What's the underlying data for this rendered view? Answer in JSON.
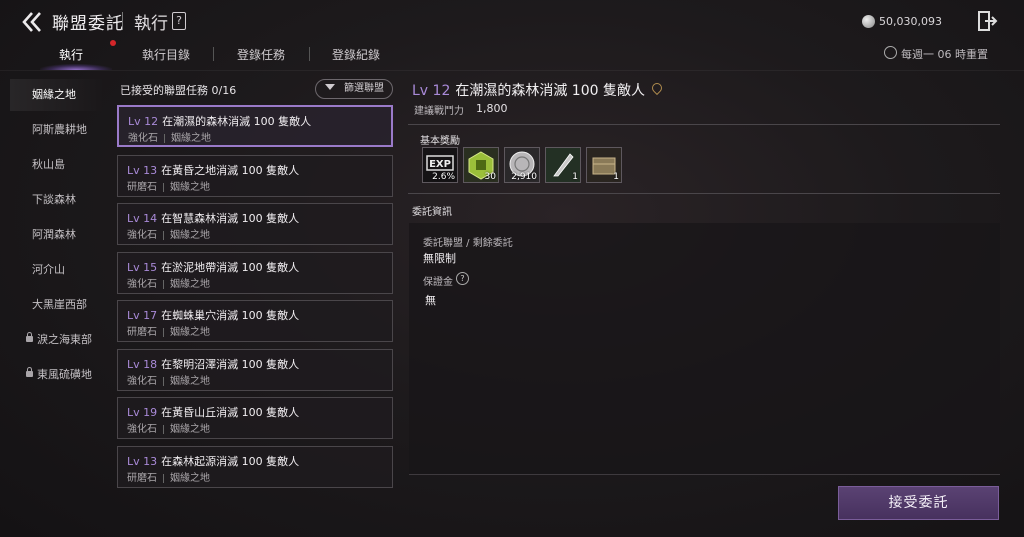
{
  "header": {
    "title": "聯盟委託",
    "subtitle": "執行",
    "currency": "50,030,093"
  },
  "tabs": [
    {
      "label": "執行",
      "active": true
    },
    {
      "label": "執行目錄"
    },
    {
      "label": "登錄任務"
    },
    {
      "label": "登錄紀錄"
    }
  ],
  "reset_text": "每週一 06 時重置",
  "regions": [
    {
      "label": "姻緣之地",
      "active": true
    },
    {
      "label": "阿斯農耕地"
    },
    {
      "label": "秋山島"
    },
    {
      "label": "下談森林"
    },
    {
      "label": "阿潤森林"
    },
    {
      "label": "河介山"
    },
    {
      "label": "大黑崖西部"
    },
    {
      "label": "淚之海東部",
      "locked": true
    },
    {
      "label": "東風硫磺地",
      "locked": true
    }
  ],
  "list": {
    "label": "已接受的聯盟任務 0/16",
    "filter_label": "篩選聯盟",
    "quests": [
      {
        "lv": "Lv 12",
        "title": "在潮濕的森林消滅 100 隻敵人",
        "item": "強化石",
        "region": "姻緣之地"
      },
      {
        "lv": "Lv 13",
        "title": "在黃昏之地消滅 100 隻敵人",
        "item": "研磨石",
        "region": "姻緣之地"
      },
      {
        "lv": "Lv 14",
        "title": "在智慧森林消滅 100 隻敵人",
        "item": "強化石",
        "region": "姻緣之地"
      },
      {
        "lv": "Lv 15",
        "title": "在淤泥地帶消滅 100 隻敵人",
        "item": "強化石",
        "region": "姻緣之地"
      },
      {
        "lv": "Lv 17",
        "title": "在蜘蛛巢穴消滅 100 隻敵人",
        "item": "研磨石",
        "region": "姻緣之地"
      },
      {
        "lv": "Lv 18",
        "title": "在黎明沼澤消滅 100 隻敵人",
        "item": "強化石",
        "region": "姻緣之地"
      },
      {
        "lv": "Lv 19",
        "title": "在黃昏山丘消滅 100 隻敵人",
        "item": "強化石",
        "region": "姻緣之地"
      },
      {
        "lv": "Lv 13",
        "title": "在森林起源消滅 100 隻敵人",
        "item": "研磨石",
        "region": "姻緣之地"
      }
    ]
  },
  "detail": {
    "lv": "Lv 12",
    "title": "在潮濕的森林消滅 100 隻敵人",
    "power_label": "建議戰鬥力",
    "power_value": "1,800",
    "reward_title": "基本獎勵",
    "rewards": [
      {
        "icon": "exp-icon",
        "count": "2.6%"
      },
      {
        "icon": "green-token-icon",
        "count": "30"
      },
      {
        "icon": "silver-coin-icon",
        "count": "2,910"
      },
      {
        "icon": "feather-icon",
        "count": "1"
      },
      {
        "icon": "chest-icon",
        "count": "1"
      }
    ],
    "info_title": "委託資訊",
    "info_label1": "委託聯盟 / 剩餘委託",
    "info_value1": "無限制",
    "info_label2": "保證金",
    "info_value2": "無"
  },
  "accept_label": "接受委託"
}
